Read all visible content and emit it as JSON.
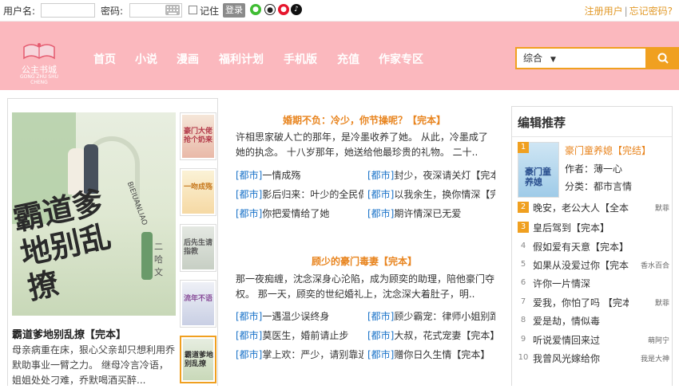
{
  "topbar": {
    "username_label": "用户名:",
    "password_label": "密码:",
    "remember_label": "记住",
    "login_button": "登录",
    "register_link": "注册用户",
    "separator": "|",
    "forgot_link": "忘记密码?",
    "social_icons": [
      "wechat-icon",
      "qq-icon",
      "weibo-icon",
      "tiktok-icon"
    ]
  },
  "header": {
    "logo_text": "公主书城",
    "logo_subtext": "GONG ZHU SHU CHENG",
    "nav": [
      "首页",
      "小说",
      "漫画",
      "福利计划",
      "手机版",
      "充值",
      "作家专区"
    ],
    "search_select": "综合",
    "search_select_arrow": "▼",
    "colors": {
      "header_bg": "#fbb8be",
      "accent": "#f0a020",
      "link_orange": "#e8841e",
      "category_blue": "#1a73c9"
    }
  },
  "featured": {
    "cover_title": "霸道爹地别乱撩",
    "cover_sub": "霸道爹地别乱撩",
    "cover_author": "二哈文",
    "cover_pinyin": "BIEIUANLIAO",
    "title": "霸道爹地别乱撩【完本】",
    "desc": "母亲病重在床，狠心父亲却只想利用乔默助事业一臂之力。 继母冷言冷语，姐姐处处刁难，乔默喝酒买醉..."
  },
  "thumbs": [
    {
      "title": "豪门大佬抢个奶来"
    },
    {
      "title": "一吻成殇"
    },
    {
      "title": "后先生请指教"
    },
    {
      "title": "流年不语"
    },
    {
      "title": "霸道爹地别乱撩"
    }
  ],
  "section1": {
    "title": "婚期不负：冷少，你节操呢？【完本】",
    "desc": "许相思家破人亡的那年，是冷墨收养了她。 从此，冷墨成了她的执念。 十八岁那年，她送给他最珍贵的礼物。 二十..",
    "items": [
      {
        "cat": "[都市]",
        "name": "一情成殇"
      },
      {
        "cat": "[都市]",
        "name": "封少，夜深请关灯【完本】"
      },
      {
        "cat": "[都市]",
        "name": "影后归来：叶少的全民偶像"
      },
      {
        "cat": "[都市]",
        "name": "以我余生，换你情深【完本】"
      },
      {
        "cat": "[都市]",
        "name": "你把爱情给了她"
      },
      {
        "cat": "[都市]",
        "name": "期许情深已无爱"
      }
    ]
  },
  "section2": {
    "title": "顾少的豪门毒妻【完本】",
    "desc": "那一夜痴缠，沈念深身心沦陷，成为顾奕的助理，陪他豪门夺权。 那一天，顾奕的世纪婚礼上，沈念深大着肚子，明..",
    "items": [
      {
        "cat": "[都市]",
        "name": "一遇温少误终身"
      },
      {
        "cat": "[都市]",
        "name": "顾少霸宠：律师小姐别跑"
      },
      {
        "cat": "[都市]",
        "name": "莫医生，婚前请止步"
      },
      {
        "cat": "[都市]",
        "name": "大叔，花式宠妻【完本】"
      },
      {
        "cat": "[都市]",
        "name": "掌上欢：严少，请别靠近"
      },
      {
        "cat": "[都市]",
        "name": "赠你日久生情【完本】"
      }
    ]
  },
  "editor": {
    "title": "编辑推荐",
    "top": {
      "rank": "1",
      "cover_title": "豪门童养媳",
      "title": "豪门童养媳【完结】",
      "author": "作者：薄一心",
      "category": "分类：都市言情"
    },
    "list": [
      {
        "rank": "2",
        "name": "晚安，老公大人【全本】",
        "author": "默菲"
      },
      {
        "rank": "3",
        "name": "皇后驾到【完本】",
        "author": ""
      },
      {
        "rank": "4",
        "name": "假如爱有天意【完本】",
        "author": ""
      },
      {
        "rank": "5",
        "name": "如果从没爱过你【完本】",
        "author": "香水百合"
      },
      {
        "rank": "6",
        "name": "许你一片情深",
        "author": ""
      },
      {
        "rank": "7",
        "name": "爱我，你怕了吗 【完本】",
        "author": "默菲"
      },
      {
        "rank": "8",
        "name": "爱是劫，情似毒",
        "author": ""
      },
      {
        "rank": "9",
        "name": "听说爱情回来过",
        "author": "萌阿宁"
      },
      {
        "rank": "10",
        "name": "我曾风光嫁给你",
        "author": "我是大神"
      }
    ]
  }
}
